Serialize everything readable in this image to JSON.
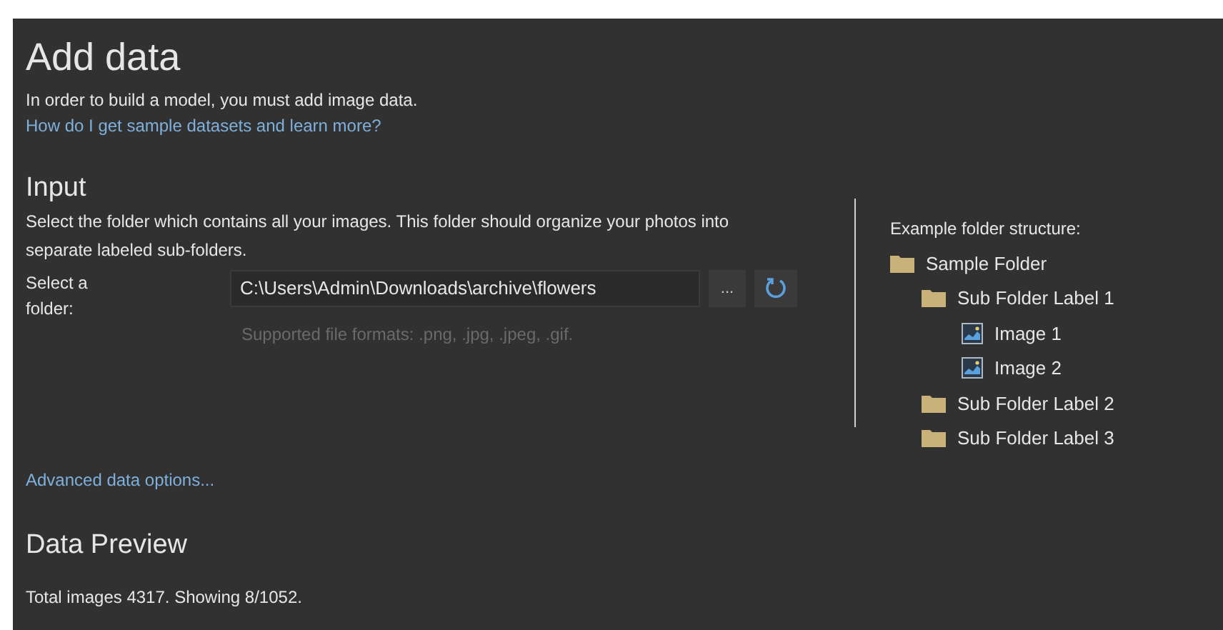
{
  "title": "Add data",
  "intro": "In order to build a model, you must add image data.",
  "help_link": "How do I get sample datasets and learn more?",
  "input": {
    "heading": "Input",
    "description": "Select the folder which contains all your images. This folder should organize your photos into separate labeled sub-folders.",
    "folder_label": "Select a folder:",
    "folder_value": "C:\\Users\\Admin\\Downloads\\archive\\flowers",
    "browse_button": "...",
    "formats_hint": "Supported file formats: .png, .jpg, .jpeg, .gif."
  },
  "example": {
    "heading": "Example folder structure:",
    "tree": [
      {
        "kind": "folder",
        "label": "Sample Folder",
        "children": [
          {
            "kind": "folder",
            "label": "Sub Folder Label 1",
            "children": [
              {
                "kind": "image",
                "label": "Image 1"
              },
              {
                "kind": "image",
                "label": "Image 2"
              }
            ]
          },
          {
            "kind": "folder",
            "label": "Sub Folder Label 2"
          },
          {
            "kind": "folder",
            "label": "Sub Folder Label 3"
          }
        ]
      }
    ]
  },
  "advanced_link": "Advanced data options...",
  "preview": {
    "heading": "Data Preview",
    "summary": "Total images 4317. Showing 8/1052."
  }
}
